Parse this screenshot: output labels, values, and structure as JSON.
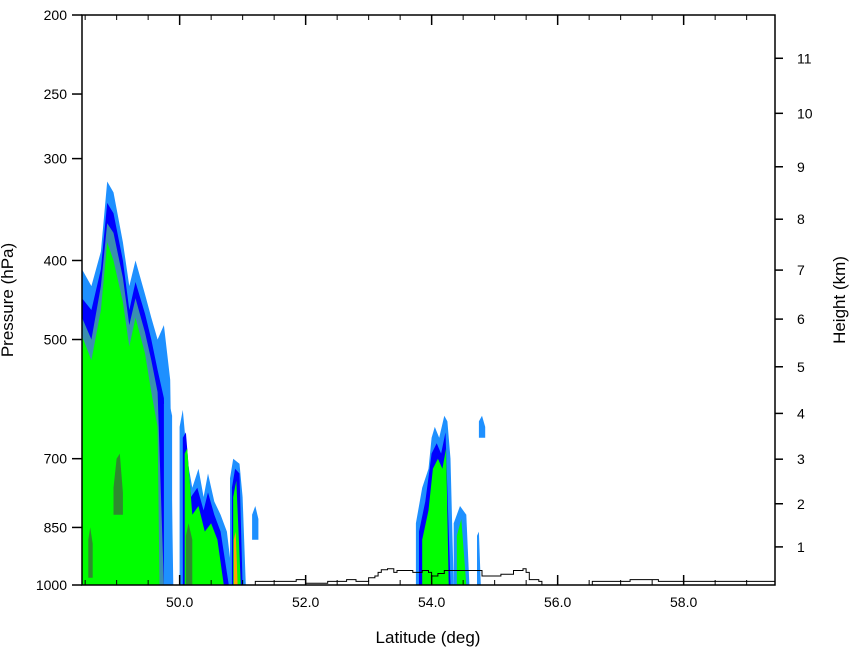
{
  "chart_data": {
    "type": "area",
    "xlabel": "Latitude (deg)",
    "ylabel": "Pressure (hPa)",
    "y2label": "Height (km)",
    "xlim": [
      48.45,
      59.45
    ],
    "ylim": [
      1000,
      200
    ],
    "yscale": "log",
    "x_ticks": [
      {
        "value": 50.0,
        "label": "50.0"
      },
      {
        "value": 52.0,
        "label": "52.0"
      },
      {
        "value": 54.0,
        "label": "54.0"
      },
      {
        "value": 56.0,
        "label": "56.0"
      },
      {
        "value": 58.0,
        "label": "58.0"
      }
    ],
    "x_minor_ticks": [
      48.5,
      49.0,
      49.5,
      50.5,
      51.0,
      51.5,
      52.5,
      53.0,
      53.5,
      54.5,
      55.0,
      55.5,
      56.5,
      57.0,
      57.5,
      58.5,
      59.0
    ],
    "y_ticks": [
      {
        "value": 1000,
        "label": "1000"
      },
      {
        "value": 850,
        "label": "850"
      },
      {
        "value": 700,
        "label": "700"
      },
      {
        "value": 500,
        "label": "500"
      },
      {
        "value": 400,
        "label": "400"
      },
      {
        "value": 300,
        "label": "300"
      },
      {
        "value": 250,
        "label": "250"
      },
      {
        "value": 200,
        "label": "200"
      }
    ],
    "y2_ticks": [
      {
        "pressure": 898,
        "label": "1"
      },
      {
        "pressure": 795,
        "label": "2"
      },
      {
        "pressure": 701,
        "label": "3"
      },
      {
        "pressure": 616,
        "label": "4"
      },
      {
        "pressure": 540,
        "label": "5"
      },
      {
        "pressure": 472,
        "label": "6"
      },
      {
        "pressure": 411,
        "label": "7"
      },
      {
        "pressure": 356,
        "label": "8"
      },
      {
        "pressure": 307,
        "label": "9"
      },
      {
        "pressure": 264,
        "label": "10"
      },
      {
        "pressure": 226,
        "label": "11"
      }
    ],
    "contour_colors": [
      "#1E90FF",
      "#0000FF",
      "#3a8fb0",
      "#00FF00",
      "#2e8b2e",
      "#FFA500"
    ],
    "plumes": [
      {
        "level": 0,
        "x0": 48.45,
        "x1": 49.9,
        "base": 1000,
        "tops": [
          [
            48.45,
            410
          ],
          [
            48.6,
            430
          ],
          [
            48.75,
            390
          ],
          [
            48.85,
            320
          ],
          [
            48.95,
            330
          ],
          [
            49.1,
            380
          ],
          [
            49.2,
            430
          ],
          [
            49.3,
            400
          ],
          [
            49.45,
            440
          ],
          [
            49.55,
            470
          ],
          [
            49.65,
            500
          ],
          [
            49.75,
            480
          ],
          [
            49.85,
            560
          ],
          [
            49.9,
            1000
          ]
        ]
      },
      {
        "level": 1,
        "x0": 48.45,
        "x1": 49.82,
        "base": 1000,
        "tops": [
          [
            48.45,
            445
          ],
          [
            48.6,
            460
          ],
          [
            48.75,
            410
          ],
          [
            48.85,
            340
          ],
          [
            48.95,
            350
          ],
          [
            49.1,
            400
          ],
          [
            49.2,
            460
          ],
          [
            49.3,
            425
          ],
          [
            49.45,
            465
          ],
          [
            49.55,
            500
          ],
          [
            49.65,
            545
          ],
          [
            49.75,
            590
          ],
          [
            49.82,
            1000
          ]
        ]
      },
      {
        "level": 2,
        "x0": 48.45,
        "x1": 49.75,
        "base": 1000,
        "tops": [
          [
            48.45,
            470
          ],
          [
            48.6,
            500
          ],
          [
            48.75,
            430
          ],
          [
            48.85,
            360
          ],
          [
            48.95,
            370
          ],
          [
            49.1,
            420
          ],
          [
            49.2,
            480
          ],
          [
            49.3,
            445
          ],
          [
            49.45,
            490
          ],
          [
            49.55,
            530
          ],
          [
            49.65,
            580
          ],
          [
            49.75,
            1000
          ]
        ]
      },
      {
        "level": 3,
        "x0": 48.45,
        "x1": 49.68,
        "base": 1000,
        "tops": [
          [
            48.45,
            495
          ],
          [
            48.6,
            530
          ],
          [
            48.75,
            460
          ],
          [
            48.85,
            380
          ],
          [
            48.95,
            400
          ],
          [
            49.1,
            450
          ],
          [
            49.2,
            510
          ],
          [
            49.3,
            470
          ],
          [
            49.45,
            520
          ],
          [
            49.55,
            580
          ],
          [
            49.65,
            640
          ],
          [
            49.68,
            1000
          ]
        ]
      },
      {
        "level": 4,
        "x0": 48.95,
        "x1": 49.1,
        "base": 820,
        "tops": [
          [
            48.95,
            760
          ],
          [
            49.0,
            700
          ],
          [
            49.05,
            690
          ],
          [
            49.1,
            770
          ]
        ]
      },
      {
        "level": 4,
        "x0": 48.55,
        "x1": 48.62,
        "base": 980,
        "tops": [
          [
            48.55,
            880
          ],
          [
            48.58,
            850
          ],
          [
            48.62,
            890
          ]
        ]
      },
      {
        "level": 0,
        "x0": 50.0,
        "x1": 50.85,
        "base": 1000,
        "tops": [
          [
            50.0,
            640
          ],
          [
            50.05,
            610
          ],
          [
            50.12,
            700
          ],
          [
            50.2,
            760
          ],
          [
            50.3,
            720
          ],
          [
            50.38,
            780
          ],
          [
            50.45,
            730
          ],
          [
            50.55,
            790
          ],
          [
            50.65,
            820
          ],
          [
            50.75,
            860
          ],
          [
            50.85,
            1000
          ]
        ]
      },
      {
        "level": 1,
        "x0": 50.05,
        "x1": 50.78,
        "base": 1000,
        "tops": [
          [
            50.05,
            660
          ],
          [
            50.1,
            650
          ],
          [
            50.18,
            780
          ],
          [
            50.28,
            760
          ],
          [
            50.38,
            810
          ],
          [
            50.45,
            770
          ],
          [
            50.55,
            820
          ],
          [
            50.65,
            860
          ],
          [
            50.78,
            1000
          ]
        ]
      },
      {
        "level": 3,
        "x0": 50.08,
        "x1": 50.7,
        "base": 1000,
        "tops": [
          [
            50.08,
            690
          ],
          [
            50.12,
            680
          ],
          [
            50.2,
            820
          ],
          [
            50.3,
            800
          ],
          [
            50.4,
            860
          ],
          [
            50.5,
            840
          ],
          [
            50.6,
            880
          ],
          [
            50.7,
            1000
          ]
        ]
      },
      {
        "level": 4,
        "x0": 50.1,
        "x1": 50.2,
        "base": 1000,
        "tops": [
          [
            50.1,
            870
          ],
          [
            50.14,
            840
          ],
          [
            50.2,
            880
          ]
        ]
      },
      {
        "level": 0,
        "x0": 50.8,
        "x1": 51.05,
        "base": 1000,
        "tops": [
          [
            50.8,
            740
          ],
          [
            50.85,
            700
          ],
          [
            50.95,
            710
          ],
          [
            51.0,
            780
          ],
          [
            51.05,
            1000
          ]
        ]
      },
      {
        "level": 1,
        "x0": 50.83,
        "x1": 51.0,
        "base": 1000,
        "tops": [
          [
            50.83,
            760
          ],
          [
            50.88,
            720
          ],
          [
            50.95,
            730
          ],
          [
            51.0,
            1000
          ]
        ]
      },
      {
        "level": 3,
        "x0": 50.85,
        "x1": 50.97,
        "base": 1000,
        "tops": [
          [
            50.85,
            780
          ],
          [
            50.9,
            745
          ],
          [
            50.97,
            1000
          ]
        ]
      },
      {
        "level": 5,
        "x0": 50.86,
        "x1": 50.92,
        "base": 1000,
        "tops": [
          [
            50.86,
            880
          ],
          [
            50.89,
            860
          ],
          [
            50.92,
            1000
          ]
        ]
      },
      {
        "level": 0,
        "x0": 51.15,
        "x1": 51.25,
        "base": 880,
        "tops": [
          [
            51.15,
            820
          ],
          [
            51.2,
            800
          ],
          [
            51.25,
            830
          ]
        ]
      },
      {
        "level": 0,
        "x0": 53.75,
        "x1": 54.35,
        "base": 1000,
        "tops": [
          [
            53.75,
            840
          ],
          [
            53.85,
            760
          ],
          [
            53.95,
            720
          ],
          [
            54.0,
            660
          ],
          [
            54.05,
            640
          ],
          [
            54.12,
            660
          ],
          [
            54.2,
            620
          ],
          [
            54.25,
            630
          ],
          [
            54.3,
            700
          ],
          [
            54.35,
            1000
          ]
        ]
      },
      {
        "level": 1,
        "x0": 53.8,
        "x1": 54.3,
        "base": 1000,
        "tops": [
          [
            53.8,
            860
          ],
          [
            53.9,
            790
          ],
          [
            54.0,
            690
          ],
          [
            54.08,
            670
          ],
          [
            54.15,
            690
          ],
          [
            54.22,
            650
          ],
          [
            54.3,
            1000
          ]
        ]
      },
      {
        "level": 3,
        "x0": 53.85,
        "x1": 54.27,
        "base": 1000,
        "tops": [
          [
            53.85,
            880
          ],
          [
            53.95,
            810
          ],
          [
            54.02,
            720
          ],
          [
            54.1,
            700
          ],
          [
            54.17,
            720
          ],
          [
            54.23,
            680
          ],
          [
            54.27,
            1000
          ]
        ]
      },
      {
        "level": 0,
        "x0": 54.35,
        "x1": 54.6,
        "base": 1000,
        "tops": [
          [
            54.35,
            840
          ],
          [
            54.45,
            800
          ],
          [
            54.55,
            820
          ],
          [
            54.6,
            1000
          ]
        ]
      },
      {
        "level": 3,
        "x0": 54.4,
        "x1": 54.55,
        "base": 1000,
        "tops": [
          [
            54.4,
            870
          ],
          [
            54.47,
            830
          ],
          [
            54.55,
            1000
          ]
        ]
      },
      {
        "level": 0,
        "x0": 54.72,
        "x1": 54.78,
        "base": 1000,
        "tops": [
          [
            54.72,
            870
          ],
          [
            54.75,
            860
          ],
          [
            54.78,
            1000
          ]
        ]
      },
      {
        "level": 0,
        "x0": 54.75,
        "x1": 54.85,
        "base": 660,
        "tops": [
          [
            54.75,
            630
          ],
          [
            54.8,
            620
          ],
          [
            54.85,
            640
          ]
        ]
      },
      {
        "level": 0,
        "x0": 49.75,
        "x1": 49.88,
        "base": 1000,
        "tops": [
          [
            49.75,
            600
          ],
          [
            49.8,
            580
          ],
          [
            49.88,
            620
          ]
        ]
      }
    ],
    "terrain": [
      [
        51.15,
        1000
      ],
      [
        51.2,
        990
      ],
      [
        51.8,
        990
      ],
      [
        51.85,
        985
      ],
      [
        51.95,
        985
      ],
      [
        52.0,
        995
      ],
      [
        52.3,
        995
      ],
      [
        52.35,
        990
      ],
      [
        52.6,
        990
      ],
      [
        52.65,
        985
      ],
      [
        52.75,
        985
      ],
      [
        52.8,
        990
      ],
      [
        52.95,
        990
      ],
      [
        53.0,
        980
      ],
      [
        53.1,
        975
      ],
      [
        53.15,
        965
      ],
      [
        53.2,
        958
      ],
      [
        53.3,
        955
      ],
      [
        53.4,
        965
      ],
      [
        53.45,
        960
      ],
      [
        53.6,
        960
      ],
      [
        53.7,
        965
      ],
      [
        53.85,
        960
      ],
      [
        53.95,
        965
      ],
      [
        54.0,
        975
      ],
      [
        54.1,
        968
      ],
      [
        54.2,
        960
      ],
      [
        54.3,
        960
      ],
      [
        54.4,
        960
      ],
      [
        54.5,
        960
      ],
      [
        54.75,
        960
      ],
      [
        54.8,
        975
      ],
      [
        54.95,
        975
      ],
      [
        55.1,
        970
      ],
      [
        55.3,
        960
      ],
      [
        55.45,
        955
      ],
      [
        55.5,
        965
      ],
      [
        55.55,
        985
      ],
      [
        55.7,
        990
      ],
      [
        55.75,
        1000
      ],
      [
        56.5,
        1000
      ],
      [
        56.55,
        990
      ],
      [
        57.1,
        990
      ],
      [
        57.15,
        985
      ],
      [
        57.5,
        985
      ],
      [
        57.6,
        990
      ],
      [
        59.45,
        990
      ]
    ]
  }
}
